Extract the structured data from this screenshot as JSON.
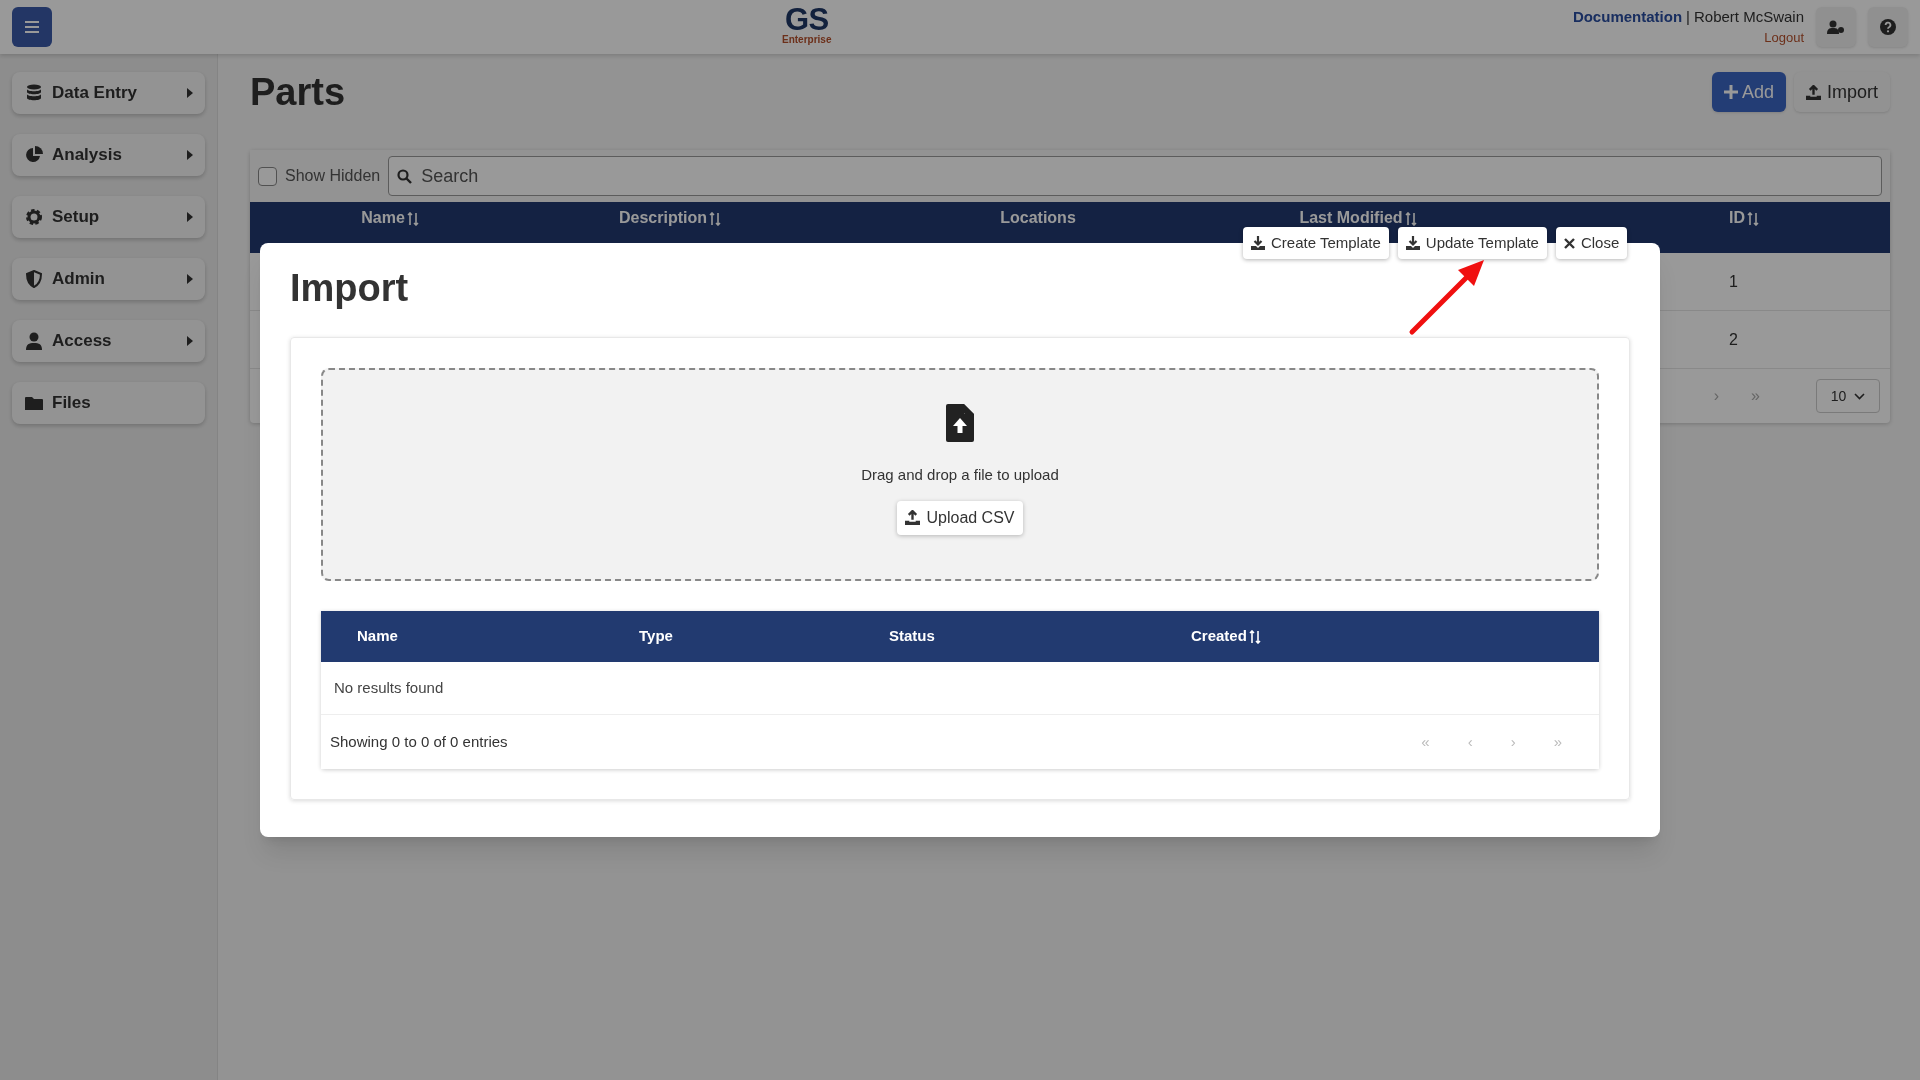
{
  "header": {
    "logo": {
      "title": "GS",
      "subtitle": "Enterprise"
    },
    "documentation": "Documentation",
    "separator": "|",
    "user": "Robert McSwain",
    "logout": "Logout"
  },
  "sidebar": {
    "items": [
      {
        "label": "Data Entry",
        "expandable": true
      },
      {
        "label": "Analysis",
        "expandable": true
      },
      {
        "label": "Setup",
        "expandable": true
      },
      {
        "label": "Admin",
        "expandable": true
      },
      {
        "label": "Access",
        "expandable": true
      },
      {
        "label": "Files",
        "expandable": false
      }
    ]
  },
  "page": {
    "title": "Parts",
    "actions": [
      {
        "label": "Add",
        "primary": true
      },
      {
        "label": "Import",
        "primary": false
      }
    ]
  },
  "filters": {
    "show_hidden": {
      "label": "Show Hidden",
      "checked": false
    },
    "search": {
      "placeholder": "Search"
    }
  },
  "table": {
    "columns": [
      {
        "label": "Name",
        "sortable": true
      },
      {
        "label": "Description",
        "sortable": true
      },
      {
        "label": "Locations",
        "sortable": false
      },
      {
        "label": "Last Modified",
        "sortable": true
      },
      {
        "label": "ID",
        "sortable": true
      }
    ],
    "rows": [
      {
        "id": "1"
      },
      {
        "id": "2"
      }
    ],
    "pagination": {
      "nav": [
        "›",
        "»"
      ],
      "page_size": "10"
    }
  },
  "modal": {
    "title": "Import",
    "toolbar": [
      {
        "label": "Create Template",
        "kind": "download"
      },
      {
        "label": "Update Template",
        "kind": "download"
      },
      {
        "label": "Close",
        "kind": "close"
      }
    ],
    "dropzone": {
      "text": "Drag and drop a file to upload",
      "button": "Upload CSV"
    },
    "table": {
      "columns": [
        {
          "label": "Name",
          "sortable": false
        },
        {
          "label": "Type",
          "sortable": false
        },
        {
          "label": "Status",
          "sortable": false
        },
        {
          "label": "Created",
          "sortable": true
        }
      ],
      "empty_text": "No results found",
      "footer": "Showing 0 to 0 of 0 entries",
      "nav": [
        "«",
        "‹",
        "›",
        "»"
      ]
    }
  }
}
